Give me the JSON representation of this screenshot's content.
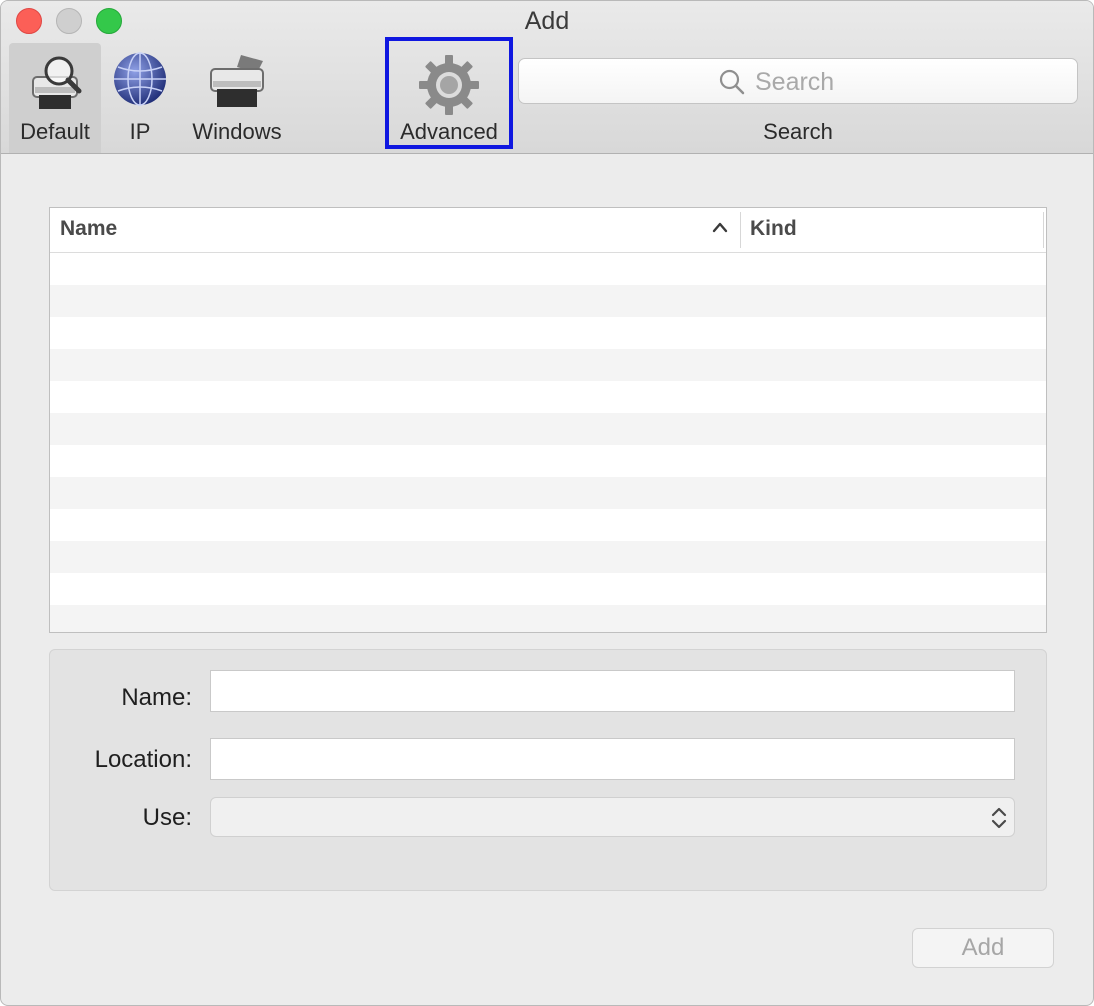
{
  "window": {
    "title": "Add"
  },
  "toolbar": {
    "items": [
      {
        "label": "Default",
        "icon": "printer-search-icon",
        "selected": true
      },
      {
        "label": "IP",
        "icon": "globe-icon",
        "selected": false
      },
      {
        "label": "Windows",
        "icon": "printer-icon",
        "selected": false
      },
      {
        "label": "Advanced",
        "icon": "gear-icon",
        "selected": false,
        "highlighted": true
      }
    ],
    "search": {
      "placeholder": "Search",
      "label": "Search"
    }
  },
  "table": {
    "columns": [
      {
        "label": "Name",
        "sort": "ascending"
      },
      {
        "label": "Kind"
      }
    ],
    "rows": []
  },
  "form": {
    "name_label": "Name:",
    "name_value": "",
    "location_label": "Location:",
    "location_value": "",
    "use_label": "Use:",
    "use_value": ""
  },
  "footer": {
    "add_label": "Add"
  },
  "colors": {
    "highlight_border": "#0f17e0",
    "close": "#fc5f57",
    "zoom": "#34c84a",
    "minimize_inactive": "#cfcfcf"
  }
}
